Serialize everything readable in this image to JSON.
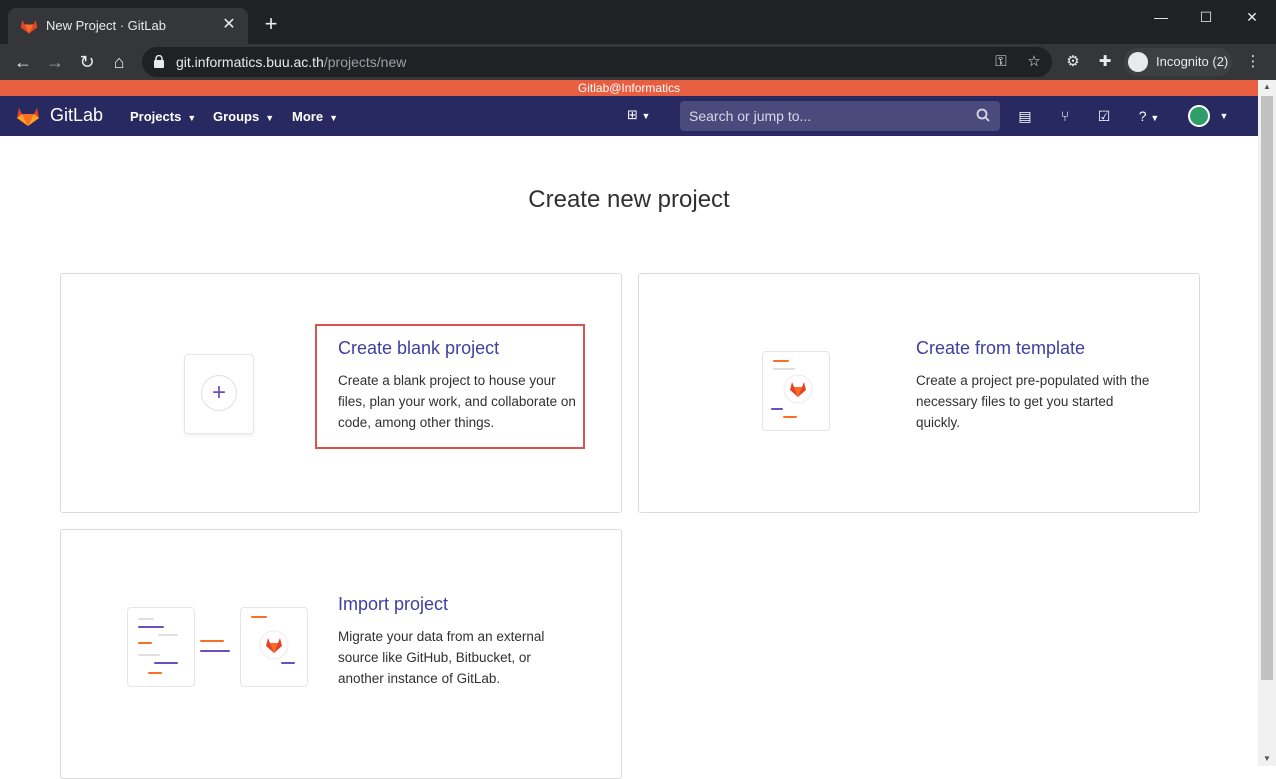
{
  "browser": {
    "tab_title": "New Project · GitLab",
    "tab_close": "✕",
    "new_tab": "+",
    "url_host": "git.informatics.buu.ac.th",
    "url_path": "/projects/new",
    "incognito_label": "Incognito (2)",
    "window_controls": {
      "minimize": "—",
      "maximize": "☐",
      "close": "✕"
    }
  },
  "gitlab": {
    "banner": "Gitlab@Informatics",
    "brand": "GitLab",
    "menus": [
      "Projects",
      "Groups",
      "More"
    ],
    "search_placeholder": "Search or jump to...",
    "colors": {
      "nav_bg": "#292961",
      "banner_bg": "#e75e40",
      "link": "#3f3f9e",
      "highlight": "#d9534f"
    }
  },
  "page": {
    "title": "Create new project",
    "cards": [
      {
        "title": "Create blank project",
        "desc": "Create a blank project to house your files, plan your work, and collaborate on code, among other things."
      },
      {
        "title": "Create from template",
        "desc": "Create a project pre-populated with the necessary files to get you started quickly."
      },
      {
        "title": "Import project",
        "desc": "Migrate your data from an external source like GitHub, Bitbucket, or another instance of GitLab."
      }
    ]
  }
}
